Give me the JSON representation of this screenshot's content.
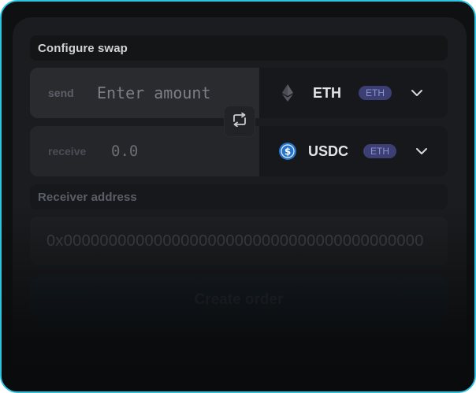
{
  "configure_swap": {
    "title": "Configure swap"
  },
  "send": {
    "label": "send",
    "placeholder": "Enter amount",
    "token": {
      "symbol": "ETH",
      "chain": "ETH",
      "icon": "ethereum-icon"
    }
  },
  "receive": {
    "label": "receive",
    "value": "0.0",
    "token": {
      "symbol": "USDC",
      "chain": "ETH",
      "icon": "usdc-icon"
    }
  },
  "swap_button": {
    "icon": "swap-arrows-icon"
  },
  "receiver": {
    "title": "Receiver address",
    "placeholder": "0x0000000000000000000000000000000000000000"
  },
  "create_order": {
    "label": "Create order"
  },
  "colors": {
    "frame_border": "#2bc3e0",
    "badge_bg": "#3b3f74",
    "usdc_blue": "#2775ca"
  }
}
